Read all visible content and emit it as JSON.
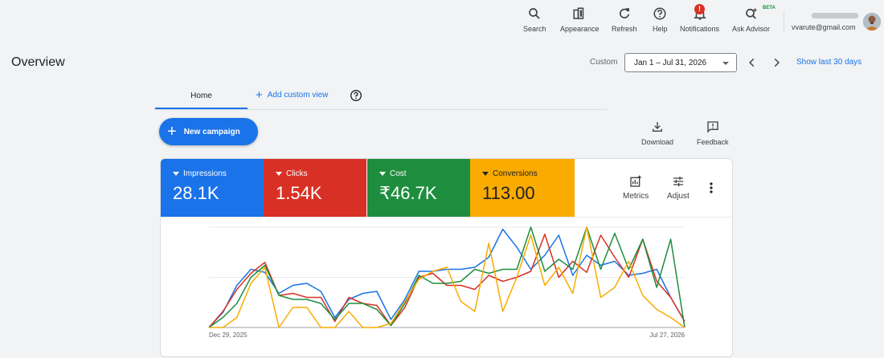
{
  "topbar": {
    "search": "Search",
    "appearance": "Appearance",
    "refresh": "Refresh",
    "help": "Help",
    "notifications": "Notifications",
    "notifications_badge": "!",
    "ask_advisor": "Ask Advisor",
    "beta": "BETA",
    "email": "vvarute@gmail.com"
  },
  "page": {
    "title": "Overview",
    "custom_label": "Custom",
    "date_range": "Jan 1 – Jul 31, 2026",
    "show_last": "Show last 30 days"
  },
  "tabs": {
    "home": "Home",
    "add_custom_view": "Add custom view"
  },
  "actions": {
    "new_campaign": "New campaign",
    "download": "Download",
    "feedback": "Feedback"
  },
  "metrics": [
    {
      "name": "Impressions",
      "value": "28.1K",
      "color": "#1a73e8"
    },
    {
      "name": "Clicks",
      "value": "1.54K",
      "color": "#d93025"
    },
    {
      "name": "Cost",
      "value": "₹46.7K",
      "color": "#1e8e3e"
    },
    {
      "name": "Conversions",
      "value": "113.00",
      "color": "#f9ab00"
    }
  ],
  "card_tools": {
    "metrics": "Metrics",
    "adjust": "Adjust"
  },
  "chart_data": {
    "type": "line",
    "x_start_label": "Dec 29, 2025",
    "x_end_label": "Jul 27, 2026",
    "grid": true,
    "ylim": [
      0,
      100
    ],
    "series": [
      {
        "name": "Impressions",
        "color": "#1a73e8",
        "values": [
          0,
          15,
          42,
          58,
          55,
          34,
          42,
          44,
          36,
          10,
          28,
          34,
          36,
          8,
          28,
          56,
          56,
          58,
          58,
          60,
          70,
          98,
          80,
          58,
          72,
          92,
          52,
          72,
          62,
          66,
          52,
          54,
          58,
          30,
          6
        ]
      },
      {
        "name": "Clicks",
        "color": "#d93025",
        "values": [
          0,
          16,
          38,
          54,
          65,
          32,
          34,
          30,
          30,
          6,
          30,
          24,
          22,
          2,
          20,
          50,
          54,
          42,
          42,
          38,
          52,
          46,
          50,
          56,
          93,
          50,
          66,
          55,
          92,
          70,
          50,
          88,
          46,
          30,
          6
        ]
      },
      {
        "name": "Cost",
        "color": "#1e8e3e",
        "values": [
          0,
          10,
          24,
          50,
          62,
          32,
          28,
          28,
          24,
          8,
          24,
          24,
          18,
          2,
          24,
          52,
          44,
          44,
          46,
          58,
          54,
          58,
          58,
          100,
          56,
          68,
          58,
          100,
          58,
          94,
          58,
          88,
          40,
          88,
          0
        ]
      },
      {
        "name": "Conversions",
        "color": "#f9ab00",
        "values": [
          0,
          0,
          10,
          44,
          60,
          0,
          20,
          20,
          0,
          0,
          16,
          0,
          0,
          4,
          26,
          48,
          56,
          60,
          26,
          16,
          84,
          16,
          50,
          92,
          42,
          60,
          34,
          100,
          30,
          40,
          66,
          32,
          18,
          10,
          0
        ]
      }
    ]
  }
}
